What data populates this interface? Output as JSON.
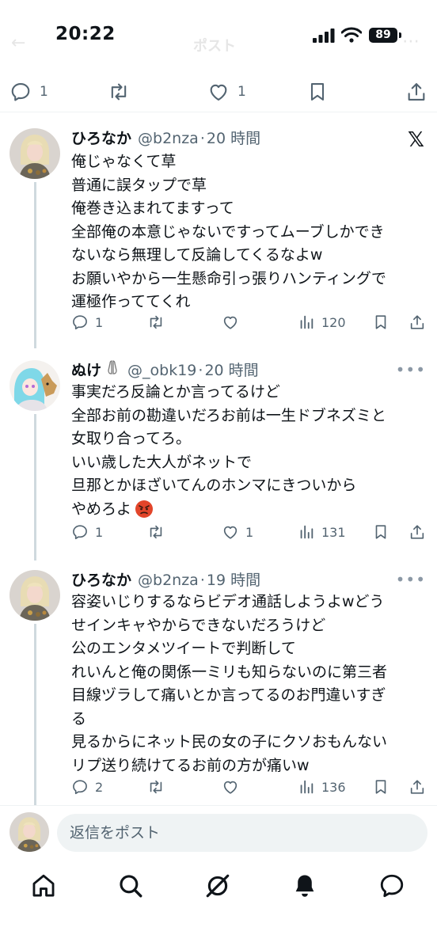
{
  "status": {
    "time": "20:22",
    "battery": "89"
  },
  "header": {
    "title": "ポスト"
  },
  "main_post_actions": {
    "replies": "1",
    "likes": "1"
  },
  "replies": [
    {
      "name": "ひろなか",
      "handle": "@b2nza",
      "time": "20 時間",
      "lines": [
        "俺じゃなくて草",
        "普通に誤タップで草",
        "俺巻き込まれてますって",
        "全部俺の本意じゃないですってムーブしかでき",
        "ないなら無理して反論してくるなよw",
        "お願いやから一生懸命引っ張りハンティングで",
        "運極作っててくれ"
      ],
      "reply_count": "1",
      "retweet_count": "",
      "like_count": "",
      "views": "120"
    },
    {
      "name": "ぬけ",
      "handle": "@_obk19",
      "time": "20 時間",
      "lines": [
        "事実だろ反論とか言ってるけど",
        "全部お前の勘違いだろお前は一生ドブネズミと",
        "女取り合ってろ。",
        "いい歳した大人がネットで",
        "旦那とかほざいてんのホンマにきついから",
        "やめろよ"
      ],
      "reply_count": "1",
      "retweet_count": "",
      "like_count": "1",
      "views": "131"
    },
    {
      "name": "ひろなか",
      "handle": "@b2nza",
      "time": "19 時間",
      "lines": [
        "容姿いじりするならビデオ通話しようよwどう",
        "せインキャやからできないだろうけど",
        "公のエンタメツイートで判断して",
        "れいんと俺の関係一ミリも知らないのに第三者",
        "目線ヅラして痛いとか言ってるのお門違いすぎ",
        "る",
        "見るからにネット民の女の子にクソおもんない",
        "リプ送り続けてるお前の方が痛いw"
      ],
      "reply_count": "2",
      "retweet_count": "",
      "like_count": "",
      "views": "136"
    }
  ],
  "reply_bar": {
    "placeholder": "返信をポスト"
  },
  "icons": {
    "reply": "reply-icon",
    "retweet": "retweet-icon",
    "like": "like-icon",
    "bookmark": "bookmark-icon",
    "share": "share-icon",
    "views": "views-icon",
    "x_logo": "x-logo-icon",
    "more": "more-icon",
    "angry_emoji": "angry-face-emoji"
  },
  "colors": {
    "text": "#0f1419",
    "secondary": "#536471",
    "divider": "#eff3f4",
    "thread": "#cfd9de"
  }
}
